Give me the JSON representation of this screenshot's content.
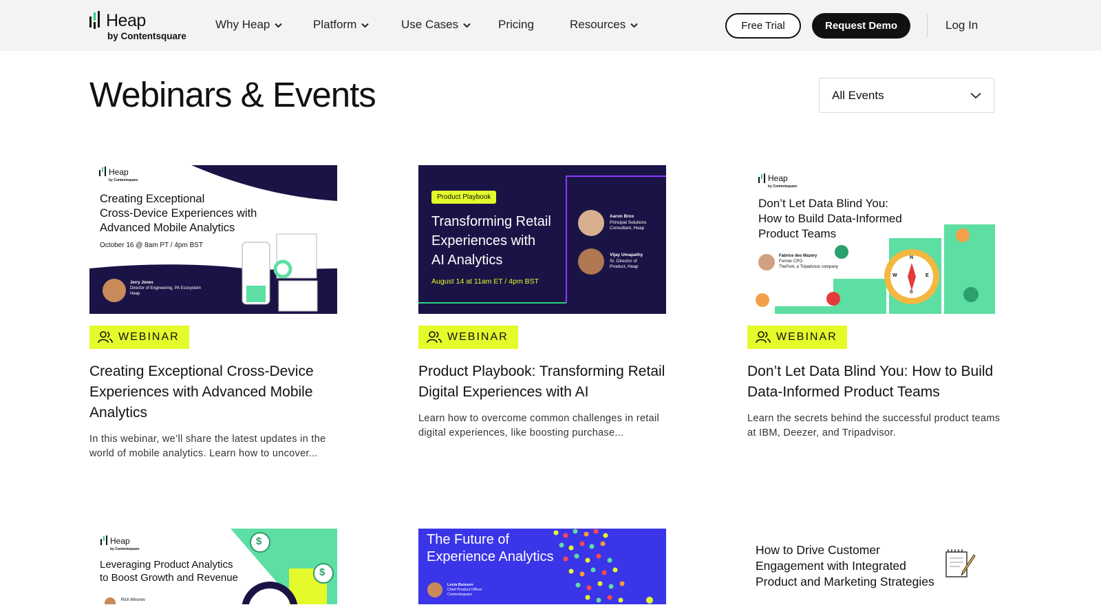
{
  "nav": {
    "brand": "Heap",
    "brand_sub": "by Contentsquare",
    "items": [
      "Why Heap",
      "Platform",
      "Use Cases",
      "Pricing",
      "Resources"
    ],
    "free_trial": "Free Trial",
    "request_demo": "Request Demo",
    "login": "Log In"
  },
  "page": {
    "title": "Webinars & Events",
    "filter_value": "All Events"
  },
  "cards": [
    {
      "badge": "WEBINAR",
      "title": "Creating Exceptional Cross-Device Experiences with Advanced Mobile Analytics",
      "desc": "In this webinar, we’ll share the latest updates in the world of mobile analytics. Learn how to uncover...",
      "thumb": {
        "brand": "Heap",
        "brand_sub": "by Contentsquare",
        "headline_l1": "Creating Exceptional",
        "headline_l2": "Cross-Device Experiences with",
        "headline_l3": "Advanced Mobile Analytics",
        "date": "October 16 @ 8am PT / 4pm BST",
        "speaker_name": "Jerry Jones",
        "speaker_role": "Director of Engineering, PA Ecosystem",
        "speaker_company": "Heap"
      }
    },
    {
      "badge": "WEBINAR",
      "title": "Product Playbook: Transforming Retail Digital Experiences with AI",
      "desc": "Learn how to overcome common challenges in retail digital experiences, like boosting purchase...",
      "thumb": {
        "tag": "Product Playbook",
        "headline_l1": "Transforming Retail",
        "headline_l2": "Experiences with",
        "headline_l3": "AI Analytics",
        "date": "August 14 at 11am ET / 4pm BST",
        "speaker1_name": "Aaron Brox",
        "speaker1_role_l1": "Principal Solutions",
        "speaker1_role_l2": "Consultant, Heap",
        "speaker2_name": "Vijay Umapathy",
        "speaker2_role_l1": "Sr. Director of",
        "speaker2_role_l2": "Product, Heap"
      }
    },
    {
      "badge": "WEBINAR",
      "title": "Don’t Let Data Blind You: How to Build Data-Informed Product Teams",
      "desc": "Learn the secrets behind the successful product teams at IBM, Deezer, and Tripadvisor.",
      "thumb": {
        "brand": "Heap",
        "brand_sub": "by Contentsquare",
        "headline_l1": "Don’t Let Data Blind You:",
        "headline_l2": "How to Build Data-Informed",
        "headline_l3": "Product Teams",
        "speaker_name": "Fabrice des Mazery",
        "speaker_role": "Former CPO",
        "speaker_company": "TheFork, a Tripadvisor company",
        "compass_n": "N",
        "compass_e": "E",
        "compass_s": "S",
        "compass_w": "W"
      }
    },
    {
      "thumb": {
        "brand": "Heap",
        "brand_sub": "by Contentsquare",
        "headline_l1": "Leveraging Product Analytics",
        "headline_l2": "to Boost Growth and Revenue",
        "speaker_name": "Rich Mironov",
        "dollar": "$"
      }
    },
    {
      "thumb": {
        "headline_l1": "The Future of",
        "headline_l2": "Experience Analytics",
        "speaker_name": "Lucia Buisson",
        "speaker_role": "Chief Product Officer",
        "speaker_company": "Contentsquare"
      }
    },
    {
      "thumb": {
        "headline_l1": "How to Drive Customer",
        "headline_l2": "Engagement with Integrated",
        "headline_l3": "Product and Marketing Strategies"
      }
    }
  ],
  "colors": {
    "badge": "#e4fa2b",
    "navy": "#1a1446",
    "green": "#5ddea3",
    "blue": "#3a35e8"
  }
}
